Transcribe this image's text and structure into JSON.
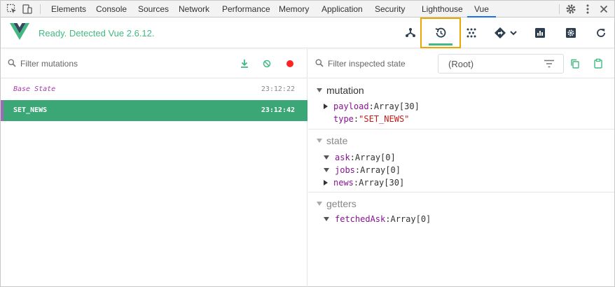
{
  "devtools": {
    "tabs": [
      "Elements",
      "Console",
      "Sources",
      "Network",
      "Performance",
      "Memory",
      "Application",
      "Security",
      "Lighthouse",
      "Vue"
    ],
    "active_tab": "Vue",
    "icons": [
      "inspect-icon",
      "device-toggle-icon",
      "settings-gear-icon",
      "more-menu-icon",
      "close-icon"
    ]
  },
  "vue": {
    "status": "Ready. Detected Vue 2.6.12.",
    "accent_color": "#42b983",
    "toolbar": [
      "components-icon",
      "vuex-history-icon",
      "events-icon",
      "routing-icon",
      "performance-icon",
      "settings-icon",
      "refresh-icon"
    ],
    "active_tool": "vuex-history-icon"
  },
  "mutations": {
    "search_placeholder": "Filter mutations",
    "actions": [
      "commit-all-icon",
      "revert-all-icon",
      "record-icon"
    ],
    "items": [
      {
        "name": "Base State",
        "time": "23:12:22"
      },
      {
        "name": "SET_NEWS",
        "time": "23:12:42",
        "selected": true
      }
    ],
    "selected_color": "#3ba776"
  },
  "inspector": {
    "search_placeholder": "Filter inspected state",
    "root_select": "(Root)",
    "actions": [
      "copy-icon",
      "paste-icon"
    ],
    "sections": [
      {
        "title": "mutation",
        "props": [
          {
            "key": "payload",
            "value": "Array[30]",
            "expand": "collapsed"
          },
          {
            "key": "type",
            "value": "\"SET_NEWS\"",
            "expand": "none"
          }
        ]
      },
      {
        "title": "state",
        "props": [
          {
            "key": "ask",
            "value": "Array[0]",
            "expand": "expanded"
          },
          {
            "key": "jobs",
            "value": "Array[0]",
            "expand": "expanded"
          },
          {
            "key": "news",
            "value": "Array[30]",
            "expand": "collapsed"
          }
        ]
      },
      {
        "title": "getters",
        "props": [
          {
            "key": "fetchedAsk",
            "value": "Array[0]",
            "expand": "expanded"
          }
        ]
      }
    ]
  }
}
